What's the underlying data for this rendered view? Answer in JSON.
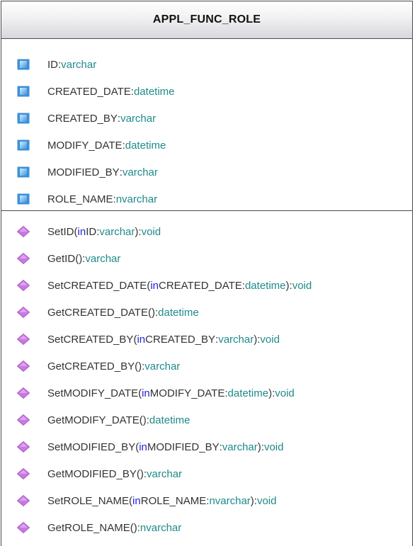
{
  "class": {
    "name": "APPL_FUNC_ROLE",
    "attributes": [
      {
        "name": "ID",
        "sep": ":",
        "type": "varchar",
        "icon": "attribute-icon"
      },
      {
        "name": "CREATED_DATE",
        "sep": ":",
        "type": "datetime",
        "icon": "attribute-icon"
      },
      {
        "name": "CREATED_BY",
        "sep": ":",
        "type": "varchar",
        "icon": "attribute-icon"
      },
      {
        "name": "MODIFY_DATE",
        "sep": ":",
        "type": "datetime",
        "icon": "attribute-icon"
      },
      {
        "name": "MODIFIED_BY",
        "sep": ":",
        "type": "varchar",
        "icon": "attribute-icon"
      },
      {
        "name": "ROLE_NAME",
        "sep": ":",
        "type": "nvarchar",
        "icon": "attribute-icon"
      }
    ],
    "operations": [
      {
        "name": "SetID",
        "open": "(",
        "kw": "in",
        "param": " ID",
        "psep": ":",
        "ptype": "varchar",
        "close": "):",
        "ret": "void"
      },
      {
        "name": "GetID",
        "open": "(",
        "kw": "",
        "param": "",
        "psep": "",
        "ptype": "",
        "close": "):",
        "ret": "varchar"
      },
      {
        "name": "SetCREATED_DATE",
        "open": "(",
        "kw": "in",
        "param": " CREATED_DATE",
        "psep": ":",
        "ptype": "datetime",
        "close": "):",
        "ret": "void"
      },
      {
        "name": "GetCREATED_DATE",
        "open": "(",
        "kw": "",
        "param": "",
        "psep": "",
        "ptype": "",
        "close": "):",
        "ret": "datetime"
      },
      {
        "name": "SetCREATED_BY",
        "open": "(",
        "kw": "in",
        "param": " CREATED_BY",
        "psep": ":",
        "ptype": "varchar",
        "close": "):",
        "ret": "void"
      },
      {
        "name": "GetCREATED_BY",
        "open": "(",
        "kw": "",
        "param": "",
        "psep": "",
        "ptype": "",
        "close": "):",
        "ret": "varchar"
      },
      {
        "name": "SetMODIFY_DATE",
        "open": "(",
        "kw": "in",
        "param": " MODIFY_DATE",
        "psep": ":",
        "ptype": "datetime",
        "close": "):",
        "ret": "void"
      },
      {
        "name": "GetMODIFY_DATE",
        "open": "(",
        "kw": "",
        "param": "",
        "psep": "",
        "ptype": "",
        "close": "):",
        "ret": "datetime"
      },
      {
        "name": "SetMODIFIED_BY",
        "open": "(",
        "kw": "in",
        "param": " MODIFIED_BY",
        "psep": ":",
        "ptype": "varchar",
        "close": "):",
        "ret": "void"
      },
      {
        "name": "GetMODIFIED_BY",
        "open": "(",
        "kw": "",
        "param": "",
        "psep": "",
        "ptype": "",
        "close": "):",
        "ret": "varchar"
      },
      {
        "name": "SetROLE_NAME",
        "open": "(",
        "kw": "in",
        "param": " ROLE_NAME",
        "psep": ":",
        "ptype": "nvarchar",
        "close": "):",
        "ret": "void"
      },
      {
        "name": "GetROLE_NAME",
        "open": "(",
        "kw": "",
        "param": "",
        "psep": "",
        "ptype": "",
        "close": "):",
        "ret": "nvarchar"
      }
    ]
  },
  "colors": {
    "attribute_icon": "#3d8fd6",
    "operation_icon": "#c978e3",
    "type_text": "#1f8a8a",
    "keyword_text": "#2323d8",
    "name_text": "#333333"
  }
}
